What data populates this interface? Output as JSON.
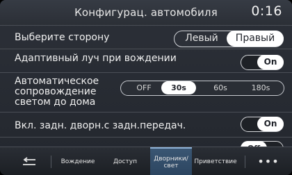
{
  "header": {
    "title": "Конфигурац. автомобиля",
    "clock": "0:16"
  },
  "rows": {
    "side": {
      "label": "Выберите сторону",
      "options": [
        "Левый",
        "Правый"
      ],
      "selected": "Правый"
    },
    "adaptive": {
      "label": "Адаптивный луч при вождении",
      "value": "On"
    },
    "follow_home": {
      "label_lines": [
        "Автоматическое",
        "сопровождение",
        "светом до дома"
      ],
      "options": [
        "OFF",
        "30s",
        "60s",
        "180s"
      ],
      "selected": "30s"
    },
    "reverse_wiper": {
      "label": "Вкл. задн. дворн.с задн.передач.",
      "value": "On"
    },
    "partial": {
      "value": "Off"
    }
  },
  "nav": {
    "back_icon": "back-arrow-icon",
    "items": [
      "Вождение",
      "Доступ",
      "Дворники/ свет",
      "Приветствие"
    ],
    "active": "Дворники/ свет",
    "more": "•••"
  }
}
